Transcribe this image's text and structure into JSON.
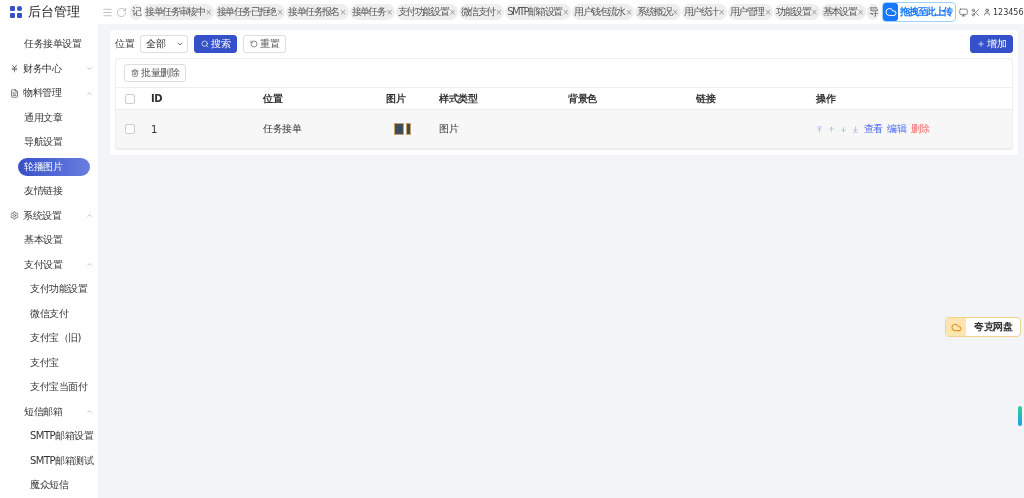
{
  "logo": {
    "title": "后台管理"
  },
  "sidebar": {
    "items": [
      {
        "kind": "item",
        "label": "任务接单设置",
        "selected": false
      },
      {
        "kind": "group",
        "label": "财务中心",
        "expanded": false
      },
      {
        "kind": "group",
        "label": "物料管理",
        "expanded": true,
        "children": [
          {
            "kind": "item",
            "label": "通用文章",
            "selected": false
          },
          {
            "kind": "item",
            "label": "导航设置",
            "selected": false
          },
          {
            "kind": "item",
            "label": "轮播图片",
            "selected": true
          },
          {
            "kind": "item",
            "label": "友情链接",
            "selected": false
          }
        ]
      },
      {
        "kind": "group",
        "label": "系统设置",
        "expanded": true,
        "children": [
          {
            "kind": "item",
            "label": "基本设置",
            "selected": false
          },
          {
            "kind": "group",
            "label": "支付设置",
            "expanded": true,
            "children": [
              {
                "kind": "item",
                "label": "支付功能设置",
                "selected": false
              },
              {
                "kind": "item",
                "label": "微信支付",
                "selected": false
              },
              {
                "kind": "item",
                "label": "支付宝（旧)",
                "selected": false
              },
              {
                "kind": "item",
                "label": "支付宝",
                "selected": false
              },
              {
                "kind": "item",
                "label": "支付宝当面付",
                "selected": false
              }
            ]
          },
          {
            "kind": "group",
            "label": "短信邮箱",
            "expanded": true,
            "children": [
              {
                "kind": "item",
                "label": "SMTP邮箱设置",
                "selected": false
              },
              {
                "kind": "item",
                "label": "SMTP邮箱测试",
                "selected": false
              },
              {
                "kind": "item",
                "label": "魔众短信",
                "selected": false
              }
            ]
          }
        ]
      }
    ]
  },
  "tabs": [
    {
      "label": "记",
      "closable": false
    },
    {
      "label": "接单任务审核中",
      "closable": true
    },
    {
      "label": "接单任务已拒绝",
      "closable": true
    },
    {
      "label": "接单任务报名",
      "closable": true
    },
    {
      "label": "接单任务",
      "closable": true
    },
    {
      "label": "支付功能设置",
      "closable": true
    },
    {
      "label": "微信支付",
      "closable": true
    },
    {
      "label": "SMTP邮箱设置",
      "closable": true
    },
    {
      "label": "用户钱包流水",
      "closable": true
    },
    {
      "label": "系统概况",
      "closable": true
    },
    {
      "label": "用户统计",
      "closable": true
    },
    {
      "label": "用户管理",
      "closable": true
    },
    {
      "label": "功能设置",
      "closable": true
    },
    {
      "label": "基本设置",
      "closable": true
    },
    {
      "label": "导",
      "closable": false
    }
  ],
  "close_mark": "×",
  "upload_widget": {
    "label": "拖拽至此上传"
  },
  "user": {
    "name": "123456"
  },
  "filter": {
    "label": "位置",
    "select_value": "全部",
    "search_button": "搜索",
    "reset_button": "重置",
    "add_button": "增加"
  },
  "batch_delete": "批量删除",
  "table": {
    "header_checked": false,
    "columns": [
      "ID",
      "位置",
      "图片",
      "样式类型",
      "背景色",
      "链接",
      "操作"
    ],
    "rows": [
      {
        "checked": false,
        "id": "1",
        "position": "任务接单",
        "style_type": "图片",
        "actions": [
          {
            "label": "查看",
            "kind": "link"
          },
          {
            "label": "编辑",
            "kind": "link"
          },
          {
            "label": "删除",
            "kind": "danger"
          }
        ]
      }
    ]
  },
  "cloud_widget": {
    "label": "夸克网盘"
  }
}
